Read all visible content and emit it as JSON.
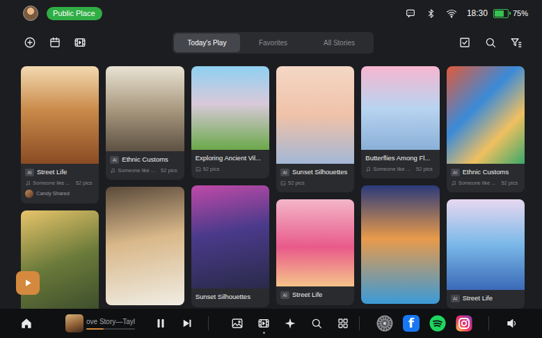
{
  "status_bar": {
    "location_badge": "Public Place",
    "time": "18:30",
    "battery": {
      "text": "75%",
      "level": 0.75
    }
  },
  "tabs": [
    {
      "label": "Today's Play",
      "selected": true
    },
    {
      "label": "Favorites",
      "selected": false
    },
    {
      "label": "All Stories",
      "selected": false
    }
  ],
  "columns": [
    [
      {
        "badge": "AI",
        "title": "Street Life",
        "meta": {
          "kind": "music",
          "text": "Someone like ...",
          "count": "52 pics"
        },
        "shared": "Candy Shared"
      },
      {}
    ],
    [
      {
        "badge": "AI",
        "title": "Ethnic Customs",
        "meta": {
          "kind": "music",
          "text": "Someone like ...",
          "count": "52 pics"
        }
      },
      {}
    ],
    [
      {
        "title": "Exploring Ancient Vil...",
        "meta": {
          "kind": "image",
          "count": "52 pics"
        }
      },
      {
        "title": "Sunset Silhouettes"
      }
    ],
    [
      {
        "badge": "AI",
        "title": "Sunset Silhouettes",
        "meta": {
          "kind": "image",
          "count": "52 pics"
        }
      },
      {
        "badge": "AI",
        "title": "Street Life"
      }
    ],
    [
      {
        "title": "Butterflies Among Fl...",
        "meta": {
          "kind": "music",
          "text": "Someone like ...",
          "count": "52 pics"
        }
      },
      {}
    ],
    [
      {
        "badge": "AI",
        "title": "Ethnic Customs",
        "meta": {
          "kind": "music",
          "text": "Someone like ...",
          "count": "52 pics"
        }
      },
      {
        "badge": "AI",
        "title": "Street Life"
      }
    ]
  ],
  "player": {
    "title": "ove Story—Tayl",
    "playing": true,
    "level": 0.35
  },
  "nav": [
    {
      "kind": "gallery",
      "active": false
    },
    {
      "kind": "film",
      "active": true
    },
    {
      "kind": "sparkle",
      "active": false
    },
    {
      "kind": "search",
      "active": false
    },
    {
      "kind": "grid",
      "active": false
    }
  ],
  "apps": [
    {
      "kind": "settings"
    },
    {
      "kind": "facebook",
      "glyph": "f"
    },
    {
      "kind": "spotify"
    },
    {
      "kind": "instagram"
    }
  ]
}
